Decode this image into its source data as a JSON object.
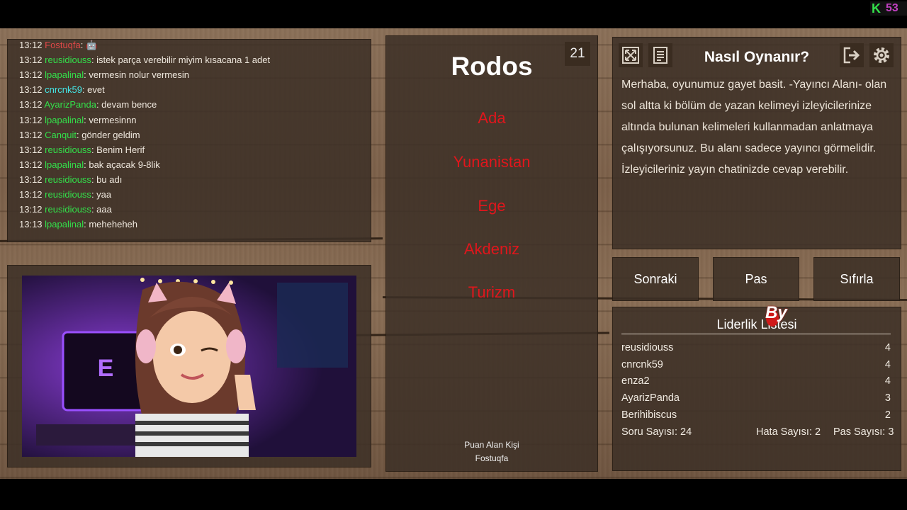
{
  "corner_badge": {
    "glyph": "K",
    "count": "53",
    "color": "#33e04a"
  },
  "chat": {
    "messages": [
      {
        "time": "13:12",
        "user": "Fostuqfa",
        "color": "#e04848",
        "text": "🤖"
      },
      {
        "time": "13:12",
        "user": "reusidiouss",
        "color": "#33e04a",
        "text": "istek parça verebilir miyim kısacana 1 adet"
      },
      {
        "time": "13:12",
        "user": "lpapalinal",
        "color": "#33e04a",
        "text": "vermesin nolur vermesin"
      },
      {
        "time": "13:12",
        "user": "cnrcnk59",
        "color": "#44e8e8",
        "text": "evet"
      },
      {
        "time": "13:12",
        "user": "AyarizPanda",
        "color": "#33e04a",
        "text": "devam bence"
      },
      {
        "time": "13:12",
        "user": "lpapalinal",
        "color": "#33e04a",
        "text": "vermesinnn"
      },
      {
        "time": "13:12",
        "user": "Canquit",
        "color": "#33e04a",
        "text": "gönder geldim"
      },
      {
        "time": "13:12",
        "user": "reusidiouss",
        "color": "#33e04a",
        "text": "Benim Herif"
      },
      {
        "time": "13:12",
        "user": "lpapalinal",
        "color": "#33e04a",
        "text": "bak açacak 9-8lik"
      },
      {
        "time": "13:12",
        "user": "reusidiouss",
        "color": "#33e04a",
        "text": "bu adı"
      },
      {
        "time": "13:12",
        "user": "reusidiouss",
        "color": "#33e04a",
        "text": "yaa"
      },
      {
        "time": "13:12",
        "user": "reusidiouss",
        "color": "#33e04a",
        "text": "aaa"
      },
      {
        "time": "13:13",
        "user": "lpapalinal",
        "color": "#33e04a",
        "text": "meheheheh"
      }
    ]
  },
  "card": {
    "counter": "21",
    "word": "Rodos",
    "taboo_words": [
      "Ada",
      "Yunanistan",
      "Ege",
      "Akdeniz",
      "Turizm"
    ],
    "scorer_label": "Puan Alan Kişi",
    "scorer_name": "Fostuqfa"
  },
  "info": {
    "title": "Nasıl Oynanır?",
    "text": "Merhaba, oyunumuz gayet basit. -Yayıncı Alanı- olan sol altta ki bölüm de yazan kelimeyi izleyicilerinize altında bulunan kelimeleri kullanmadan anlatmaya çalışıyorsunuz. Bu alanı sadece yayıncı görmelidir. İzleyicileriniz yayın chatinizde cevap verebilir.",
    "icons": [
      "fullscreen-icon",
      "notes-icon",
      "exit-icon",
      "gear-icon"
    ]
  },
  "buttons": {
    "next": "Sonraki",
    "pass": "Pas",
    "reset": "Sıfırla"
  },
  "leaderboard": {
    "title": "Liderlik Listesi",
    "rows": [
      {
        "name": "reusidiouss",
        "score": "4"
      },
      {
        "name": "cnrcnk59",
        "score": "4"
      },
      {
        "name": "enza2",
        "score": "4"
      },
      {
        "name": "AyarizPanda",
        "score": "3"
      },
      {
        "name": "Berihibiscus",
        "score": "2"
      }
    ],
    "question_count": "Soru Sayısı: 24",
    "error_count": "Hata Sayısı: 2",
    "pass_count": "Pas Sayısı: 3"
  },
  "watermark": "By"
}
